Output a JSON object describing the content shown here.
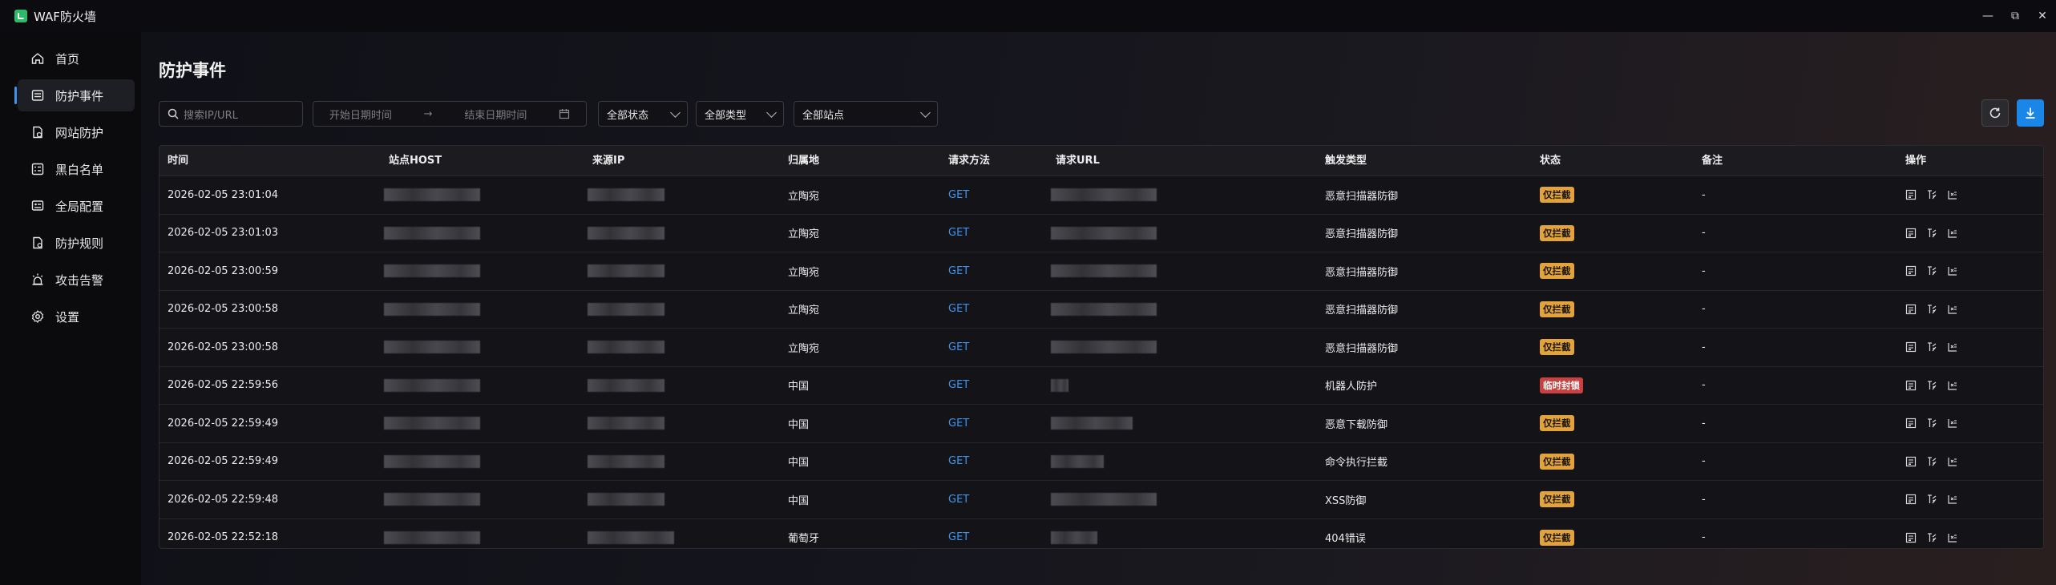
{
  "app": {
    "title": "WAF防火墙"
  },
  "window_controls": {
    "minimize": "—",
    "maximize": "⧉",
    "close": "✕"
  },
  "sidebar": {
    "items": [
      {
        "label": "首页",
        "icon": "home-icon"
      },
      {
        "label": "防护事件",
        "icon": "list-icon",
        "active": true
      },
      {
        "label": "网站防护",
        "icon": "page-shield-icon"
      },
      {
        "label": "黑白名单",
        "icon": "list-check-icon"
      },
      {
        "label": "全局配置",
        "icon": "global-settings-icon"
      },
      {
        "label": "防护规则",
        "icon": "rules-icon"
      },
      {
        "label": "攻击告警",
        "icon": "alarm-icon"
      },
      {
        "label": "设置",
        "icon": "gear-icon"
      }
    ]
  },
  "page": {
    "title": "防护事件"
  },
  "filters": {
    "search_placeholder": "搜索IP/URL",
    "start_date_placeholder": "开始日期时间",
    "end_date_placeholder": "结束日期时间",
    "status": "全部状态",
    "type": "全部类型",
    "site": "全部站点"
  },
  "colors": {
    "accent": "#3d95f0",
    "intercepted": "#e2a33a",
    "temp_blocked": "#c84040"
  },
  "table": {
    "columns": [
      "时间",
      "站点HOST",
      "来源IP",
      "归属地",
      "请求方法",
      "请求URL",
      "触发类型",
      "状态",
      "备注",
      "操作"
    ],
    "rows": [
      {
        "time": "2026-02-05 23:01:04",
        "location": "立陶宛",
        "method": "GET",
        "trigger": "恶意扫描器防御",
        "status": "仅拦截",
        "status_type": "warn",
        "note": "-",
        "url_w": 132
      },
      {
        "time": "2026-02-05 23:01:03",
        "location": "立陶宛",
        "method": "GET",
        "trigger": "恶意扫描器防御",
        "status": "仅拦截",
        "status_type": "warn",
        "note": "-",
        "url_w": 132
      },
      {
        "time": "2026-02-05 23:00:59",
        "location": "立陶宛",
        "method": "GET",
        "trigger": "恶意扫描器防御",
        "status": "仅拦截",
        "status_type": "warn",
        "note": "-",
        "url_w": 132
      },
      {
        "time": "2026-02-05 23:00:58",
        "location": "立陶宛",
        "method": "GET",
        "trigger": "恶意扫描器防御",
        "status": "仅拦截",
        "status_type": "warn",
        "note": "-",
        "url_w": 132
      },
      {
        "time": "2026-02-05 23:00:58",
        "location": "立陶宛",
        "method": "GET",
        "trigger": "恶意扫描器防御",
        "status": "仅拦截",
        "status_type": "warn",
        "note": "-",
        "url_w": 132
      },
      {
        "time": "2026-02-05 22:59:56",
        "location": "中国",
        "method": "GET",
        "trigger": "机器人防护",
        "status": "临时封锁",
        "status_type": "danger",
        "note": "-",
        "url_w": 22
      },
      {
        "time": "2026-02-05 22:59:49",
        "location": "中国",
        "method": "GET",
        "trigger": "恶意下载防御",
        "status": "仅拦截",
        "status_type": "warn",
        "note": "-",
        "url_w": 102
      },
      {
        "time": "2026-02-05 22:59:49",
        "location": "中国",
        "method": "GET",
        "trigger": "命令执行拦截",
        "status": "仅拦截",
        "status_type": "warn",
        "note": "-",
        "url_w": 66
      },
      {
        "time": "2026-02-05 22:59:48",
        "location": "中国",
        "method": "GET",
        "trigger": "XSS防御",
        "status": "仅拦截",
        "status_type": "warn",
        "note": "-",
        "url_w": 132
      },
      {
        "time": "2026-02-05 22:52:18",
        "location": "葡萄牙",
        "method": "GET",
        "trigger": "404错误",
        "status": "仅拦截",
        "status_type": "warn",
        "note": "-",
        "url_w": 58
      }
    ],
    "row_actions": [
      "detail-icon",
      "rule-icon",
      "block-icon"
    ]
  }
}
